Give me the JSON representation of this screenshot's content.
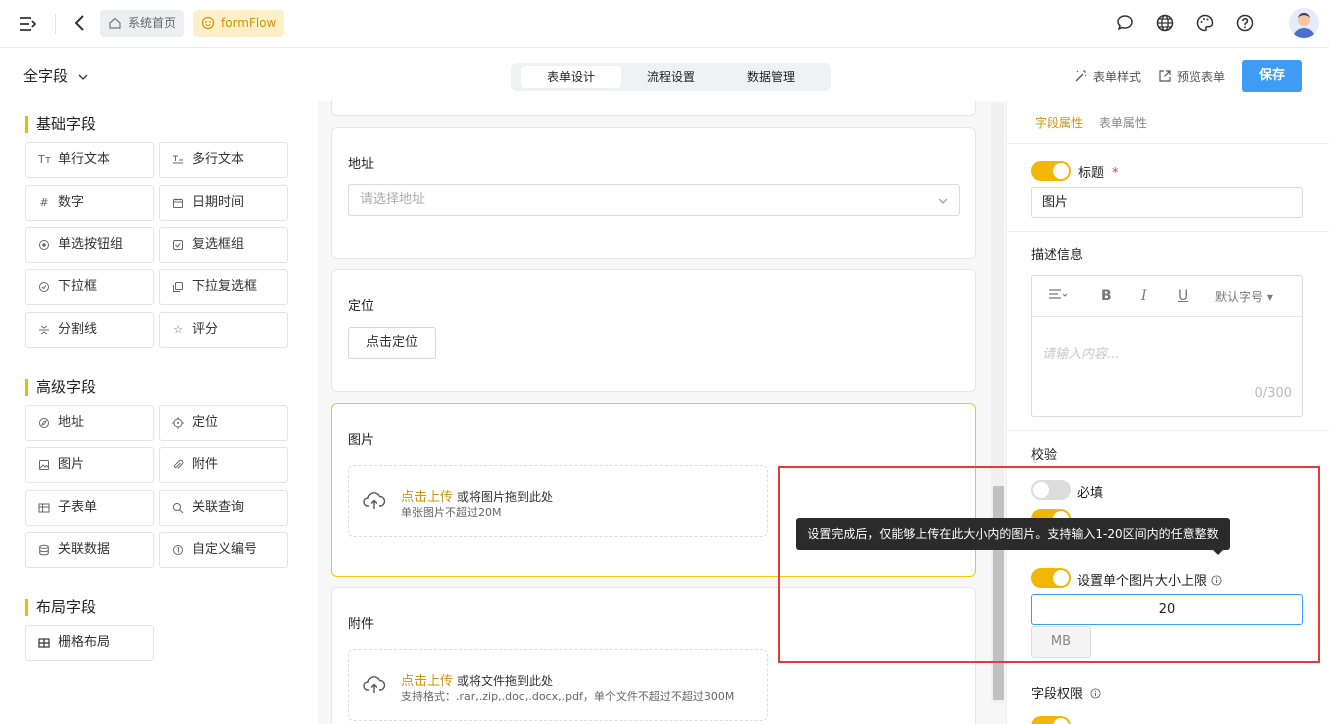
{
  "topbar": {
    "home_crumb": "系统首页",
    "app_crumb": "formFlow",
    "icons": [
      "menu-icon",
      "back-icon",
      "chat-icon",
      "globe-icon",
      "palette-icon",
      "help-icon",
      "avatar"
    ]
  },
  "subbar": {
    "field_filter": "全字段",
    "tabs": [
      "表单设计",
      "流程设置",
      "数据管理"
    ],
    "active_tab": "表单设计",
    "form_style": "表单样式",
    "preview": "预览表单",
    "save": "保存"
  },
  "left": {
    "groups": [
      {
        "title": "基础字段",
        "items": [
          {
            "label": "单行文本",
            "icon": "text-icon"
          },
          {
            "label": "多行文本",
            "icon": "multiline-icon"
          },
          {
            "label": "数字",
            "icon": "hash-icon"
          },
          {
            "label": "日期时间",
            "icon": "calendar-icon"
          },
          {
            "label": "单选按钮组",
            "icon": "radio-icon"
          },
          {
            "label": "复选框组",
            "icon": "checkbox-icon"
          },
          {
            "label": "下拉框",
            "icon": "dropdown-icon"
          },
          {
            "label": "下拉复选框",
            "icon": "multi-dropdown-icon"
          },
          {
            "label": "分割线",
            "icon": "divider-icon"
          },
          {
            "label": "评分",
            "icon": "star-icon"
          }
        ]
      },
      {
        "title": "高级字段",
        "items": [
          {
            "label": "地址",
            "icon": "compass-icon"
          },
          {
            "label": "定位",
            "icon": "locate-icon"
          },
          {
            "label": "图片",
            "icon": "image-icon"
          },
          {
            "label": "附件",
            "icon": "attachment-icon"
          },
          {
            "label": "子表单",
            "icon": "table-icon"
          },
          {
            "label": "关联查询",
            "icon": "search-icon"
          },
          {
            "label": "关联数据",
            "icon": "database-icon"
          },
          {
            "label": "自定义编号",
            "icon": "number-icon"
          }
        ]
      },
      {
        "title": "布局字段",
        "items": [
          {
            "label": "栅格布局",
            "icon": "grid-icon"
          }
        ]
      }
    ]
  },
  "canvas": {
    "address": {
      "title": "地址",
      "placeholder": "请选择地址"
    },
    "location": {
      "title": "定位",
      "button": "点击定位"
    },
    "image": {
      "title": "图片",
      "upload_link": "点击上传",
      "upload_text": "或将图片拖到此处",
      "hint": "单张图片不超过20M"
    },
    "attachment": {
      "title": "附件",
      "upload_link": "点击上传",
      "upload_text": "或将文件拖到此处",
      "hint": "支持格式：.rar,.zip,.doc,.docx,.pdf，单个文件不超过不超过300M"
    }
  },
  "right": {
    "tabs": [
      "字段属性",
      "表单属性"
    ],
    "active_tab": "字段属性",
    "title_label": "标题",
    "required_mark": "*",
    "title_value": "图片",
    "desc_label": "描述信息",
    "editor": {
      "font_size": "默认字号",
      "placeholder": "请输入内容...",
      "count": "0/300"
    },
    "validation_label": "校验",
    "required_label": "必填",
    "size_limit_label": "设置单个图片大小上限",
    "size_value": "20",
    "size_unit": "MB",
    "perm_label": "字段权限"
  },
  "tooltip": "设置完成后，仅能够上传在此大小内的图片。支持输入1-20区间内的任意整数",
  "colors": {
    "accent": "#f2b705",
    "primary": "#3e9cf5",
    "highlight": "#e33a3a"
  }
}
